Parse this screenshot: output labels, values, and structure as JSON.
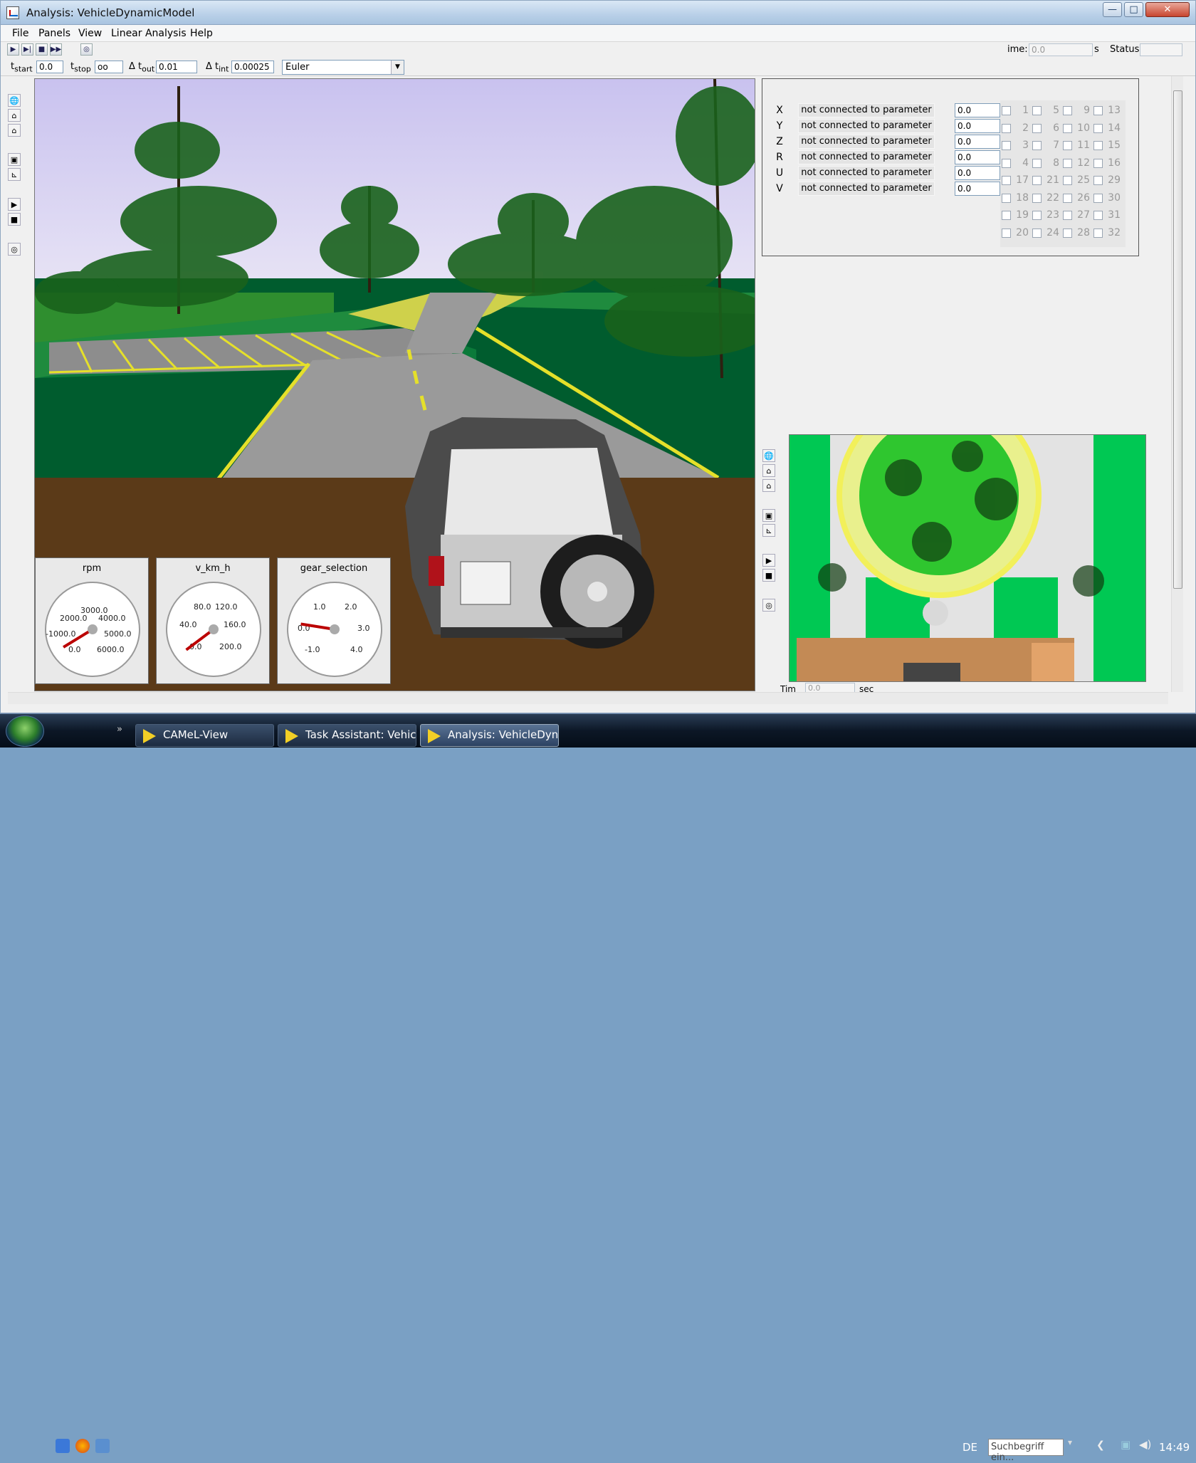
{
  "window": {
    "title": "Analysis: VehicleDynamicModel",
    "controls": {
      "minimize": "—",
      "maximize": "□",
      "close": "✕"
    }
  },
  "menu": [
    "File",
    "Panels",
    "View",
    "Linear Analysis",
    "Help"
  ],
  "toolbar": {
    "buttons": [
      "play-icon",
      "step-icon",
      "stop-icon",
      "fast-forward-icon",
      "settings-icon"
    ],
    "time_label": "ime:",
    "time_value": "0.0",
    "time_unit": "s",
    "status_label": "Status:",
    "status_value": ""
  },
  "sim_params": {
    "t_start_label": "t",
    "t_start_sub": "start",
    "t_start_value": "0.0",
    "t_stop_label": "t",
    "t_stop_sub": "stop",
    "t_stop_value": "oo",
    "dt_out_label": "Δ t",
    "dt_out_sub": "out",
    "dt_out_value": "0.01",
    "dt_int_label": "Δ t",
    "dt_int_sub": "int",
    "dt_int_value": "0.00025",
    "solver": "Euler"
  },
  "param_panel": {
    "rows": [
      {
        "axis": "X",
        "label": "not connected to parameter",
        "value": "0.0"
      },
      {
        "axis": "Y",
        "label": "not connected to parameter",
        "value": "0.0"
      },
      {
        "axis": "Z",
        "label": "not connected to parameter",
        "value": "0.0"
      },
      {
        "axis": "R",
        "label": "not connected to parameter",
        "value": "0.0"
      },
      {
        "axis": "U",
        "label": "not connected to parameter",
        "value": "0.0"
      },
      {
        "axis": "V",
        "label": "not connected to parameter",
        "value": "0.0"
      }
    ],
    "buttons": [
      "1",
      "5",
      "9",
      "13",
      "2",
      "6",
      "10",
      "14",
      "3",
      "7",
      "11",
      "15",
      "4",
      "8",
      "12",
      "16",
      "17",
      "21",
      "25",
      "29",
      "18",
      "22",
      "26",
      "30",
      "19",
      "23",
      "27",
      "31",
      "20",
      "24",
      "28",
      "32"
    ]
  },
  "gauges": [
    {
      "title": "rpm",
      "labels": [
        "3000.0",
        "2000.0",
        "4000.0",
        "-1000.0",
        "5000.0",
        "0.0",
        "6000.0"
      ],
      "value_fraction": 0.05
    },
    {
      "title": "v_km_h",
      "labels": [
        "80.0",
        "120.0",
        "40.0",
        "160.0",
        "0.0",
        "200.0"
      ],
      "value_fraction": 0.03
    },
    {
      "title": "gear_selection",
      "labels": [
        "1.0",
        "2.0",
        "0.0",
        "3.0",
        "-1.0",
        "4.0"
      ],
      "value_fraction": 0.2
    }
  ],
  "topview": {
    "time_label": "Tim",
    "time_value": "0.0",
    "time_unit": "sec"
  },
  "taskbar": {
    "items": [
      {
        "label": "CAMeL-View"
      },
      {
        "label": "Task Assistant: Vehicl..."
      },
      {
        "label": "Analysis: VehicleDyn..."
      }
    ],
    "lang": "DE",
    "search_placeholder": "Suchbegriff ein...",
    "clock": "14:49"
  }
}
